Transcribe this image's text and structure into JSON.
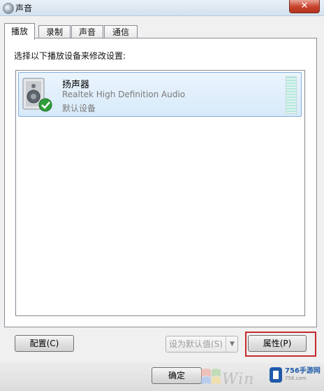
{
  "window": {
    "title": "声音",
    "close_symbol": "✕"
  },
  "tabs": [
    {
      "label": "播放",
      "active": true
    },
    {
      "label": "录制",
      "active": false
    },
    {
      "label": "声音",
      "active": false
    },
    {
      "label": "通信",
      "active": false
    }
  ],
  "instruction": "选择以下播放设备来修改设置:",
  "devices": [
    {
      "name": "扬声器",
      "description": "Realtek High Definition Audio",
      "status": "默认设备",
      "icon": "speaker-icon",
      "badge_icon": "default-check-icon"
    }
  ],
  "buttons": {
    "configure": "配置(C)",
    "set_default": "设为默认值(S)",
    "set_default_arrow": "▼",
    "properties": "属性(P)",
    "ok": "确定"
  },
  "watermark": {
    "text": "Win",
    "site_name": "756手游网",
    "site_sub": "756.com"
  },
  "colors": {
    "highlight": "#c42b2b",
    "selection": "#d7eaf9",
    "check": "#2e9e3a"
  }
}
